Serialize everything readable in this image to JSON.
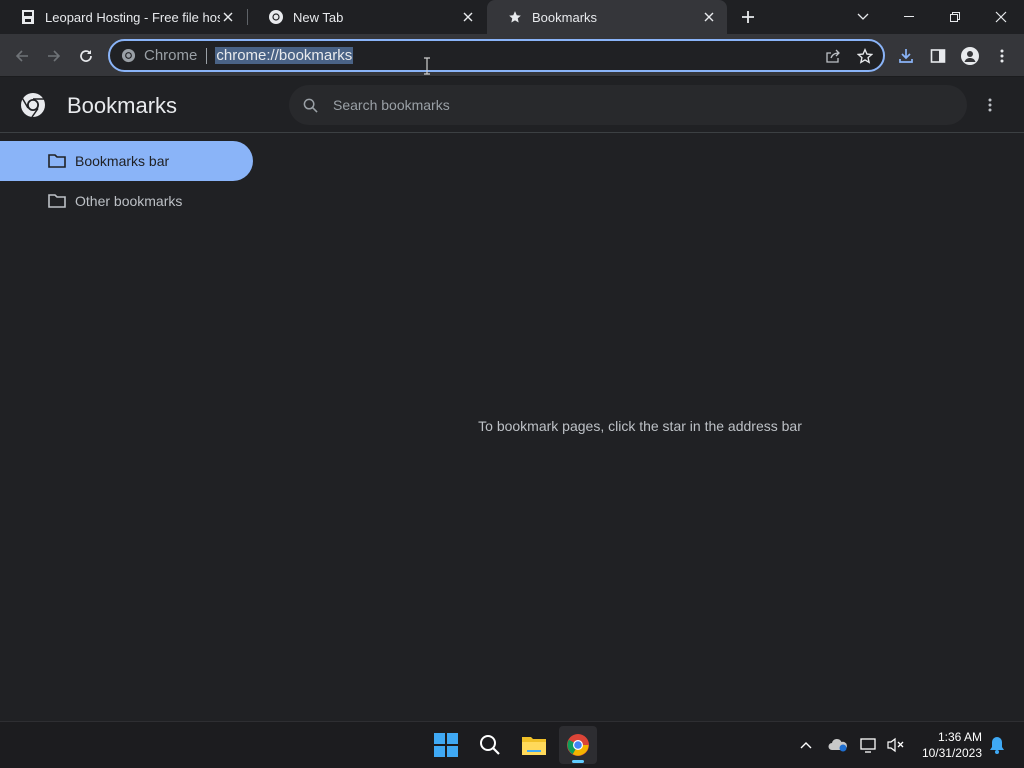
{
  "tabs": [
    {
      "title": "Leopard Hosting - Free file hosting",
      "icon": "file-icon"
    },
    {
      "title": "New Tab",
      "icon": "chrome-icon"
    },
    {
      "title": "Bookmarks",
      "icon": "star-icon",
      "active": true
    }
  ],
  "omnibox": {
    "chip_label": "Chrome",
    "url": "chrome://bookmarks"
  },
  "page": {
    "title": "Bookmarks",
    "search_placeholder": "Search bookmarks",
    "folders": [
      {
        "label": "Bookmarks bar",
        "selected": true
      },
      {
        "label": "Other bookmarks",
        "selected": false
      }
    ],
    "empty_message": "To bookmark pages, click the star in the address bar"
  },
  "taskbar": {
    "time": "1:36 AM",
    "date": "10/31/2023"
  },
  "colors": {
    "accent": "#8ab4f8",
    "background": "#202124",
    "toolbar": "#35363a"
  }
}
